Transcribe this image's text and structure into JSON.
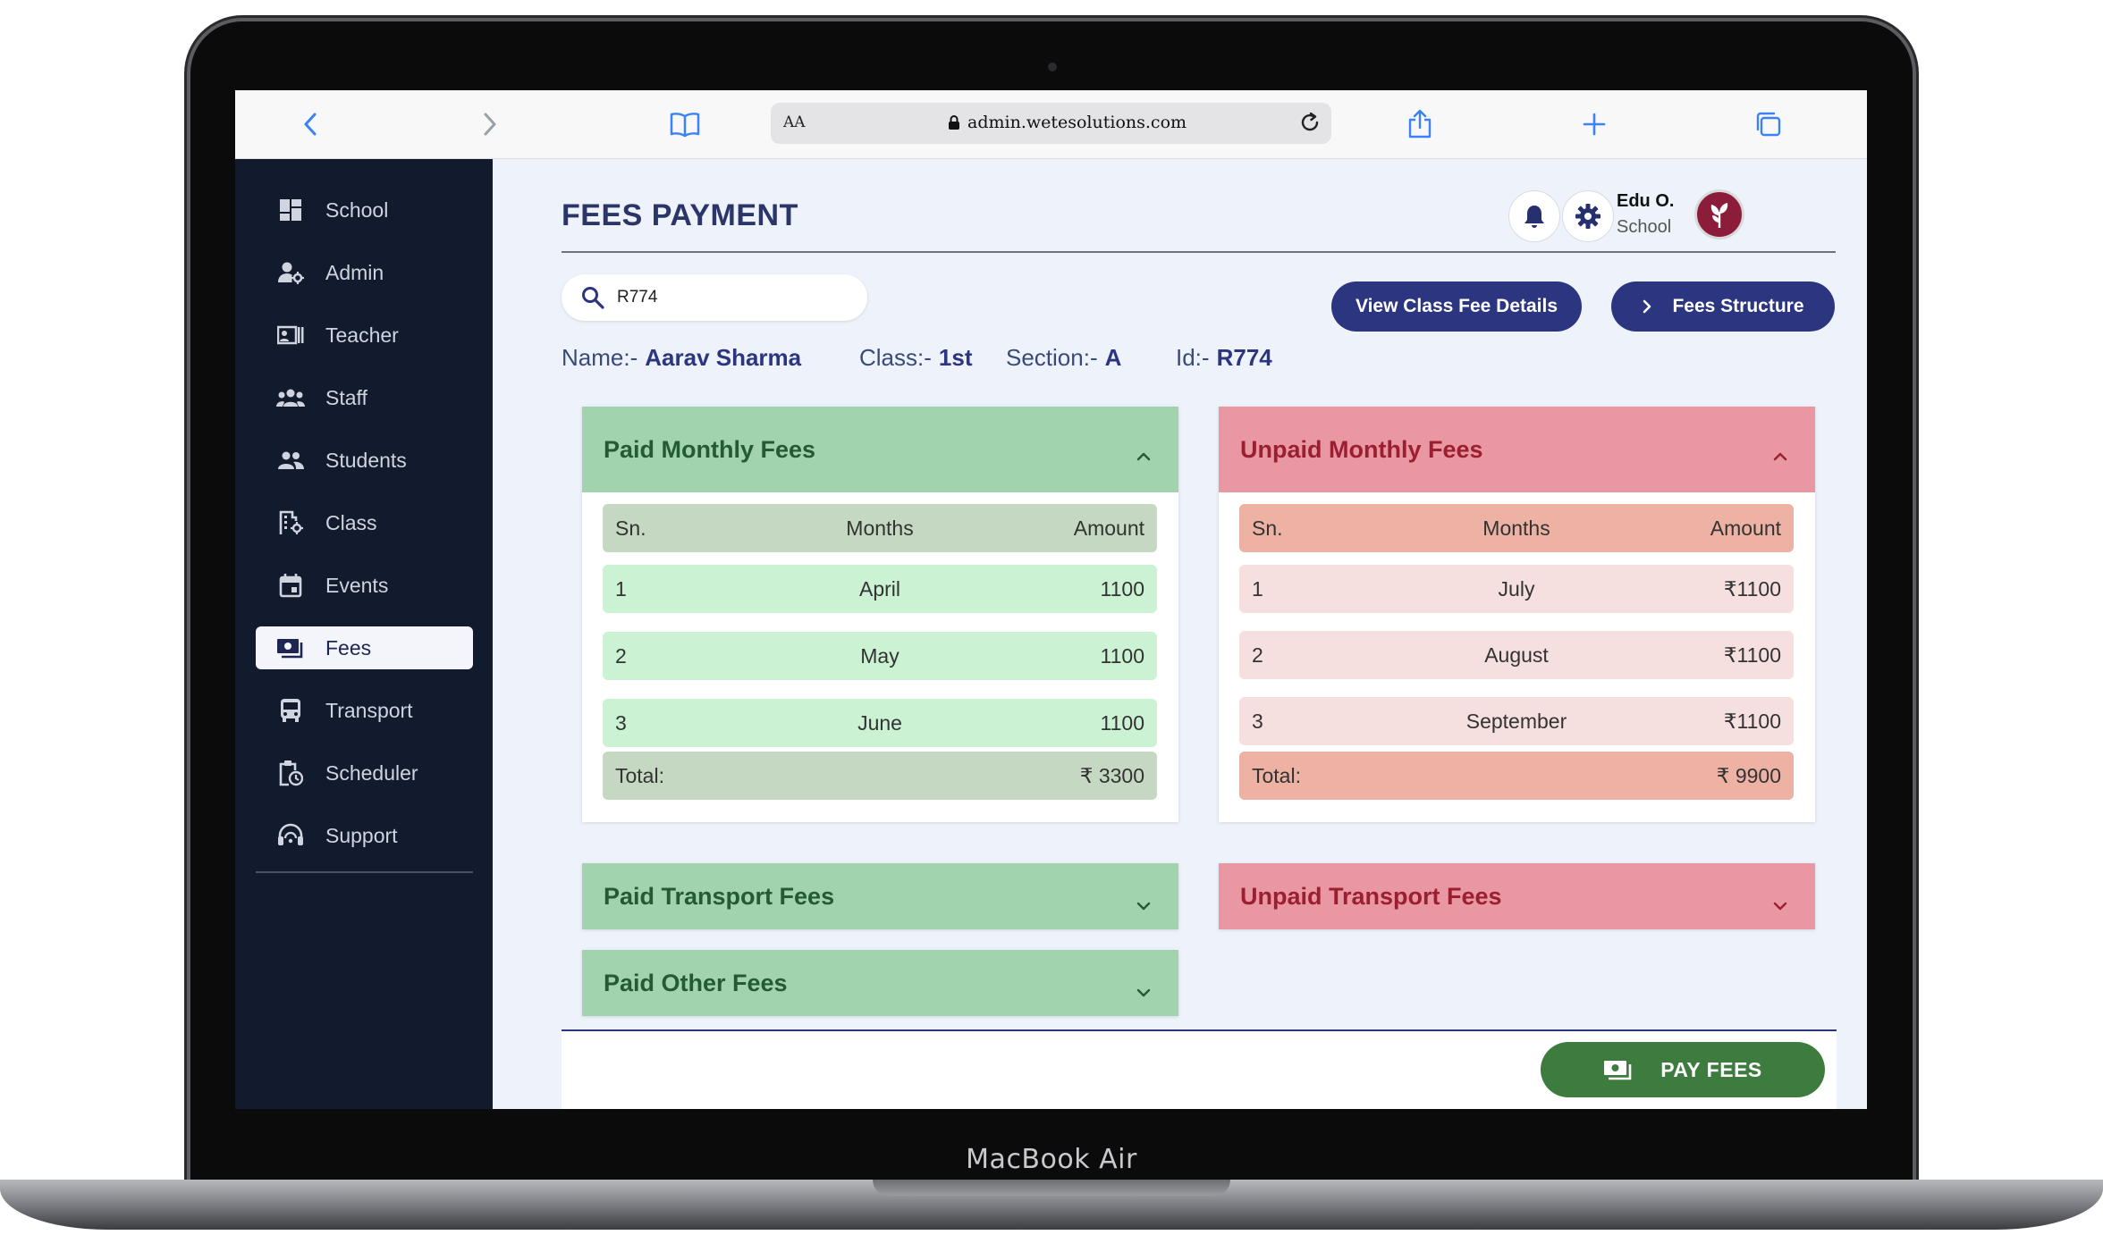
{
  "device": {
    "label": "MacBook Air"
  },
  "browser": {
    "text_size_label": "AA",
    "url": "admin.wetesolutions.com"
  },
  "sidebar": {
    "items": [
      {
        "label": "School",
        "icon": "dashboard-icon"
      },
      {
        "label": "Admin",
        "icon": "admin-user-icon"
      },
      {
        "label": "Teacher",
        "icon": "teacher-icon"
      },
      {
        "label": "Staff",
        "icon": "staff-group-icon"
      },
      {
        "label": "Students",
        "icon": "students-icon"
      },
      {
        "label": "Class",
        "icon": "class-icon"
      },
      {
        "label": "Events",
        "icon": "calendar-icon"
      },
      {
        "label": "Fees",
        "icon": "money-icon",
        "active": true
      },
      {
        "label": "Transport",
        "icon": "bus-icon"
      },
      {
        "label": "Scheduler",
        "icon": "clipboard-clock-icon"
      },
      {
        "label": "Support",
        "icon": "headset-icon"
      }
    ]
  },
  "header": {
    "title": "FEES PAYMENT",
    "user_name": "Edu O.",
    "user_role": "School"
  },
  "search": {
    "value": "R774"
  },
  "actions": {
    "view_class_fee": "View Class Fee Details",
    "fees_structure": "Fees Structure"
  },
  "student": {
    "name_label": "Name:-",
    "name": "Aarav Sharma",
    "class_label": "Class:-",
    "class": "1st",
    "section_label": "Section:-",
    "section": "A",
    "id_label": "Id:-",
    "id": "R774"
  },
  "paid_monthly": {
    "title": "Paid Monthly Fees",
    "columns": [
      "Sn.",
      "Months",
      "Amount"
    ],
    "rows": [
      {
        "sn": "1",
        "month": "April",
        "amount": "1100"
      },
      {
        "sn": "2",
        "month": "May",
        "amount": "1100"
      },
      {
        "sn": "3",
        "month": "June",
        "amount": "1100"
      }
    ],
    "total_label": "Total:",
    "total": "₹ 3300"
  },
  "unpaid_monthly": {
    "title": "Unpaid Monthly Fees",
    "columns": [
      "Sn.",
      "Months",
      "Amount"
    ],
    "rows": [
      {
        "sn": "1",
        "month": "July",
        "amount": "₹1100"
      },
      {
        "sn": "2",
        "month": "August",
        "amount": "₹1100"
      },
      {
        "sn": "3",
        "month": "September",
        "amount": "₹1100"
      }
    ],
    "total_label": "Total:",
    "total": "₹ 9900"
  },
  "paid_transport": {
    "title": "Paid Transport Fees"
  },
  "unpaid_transport": {
    "title": "Unpaid Transport Fees"
  },
  "paid_other": {
    "title": "Paid Other Fees"
  },
  "pay_button": {
    "label": "PAY FEES"
  },
  "colors": {
    "sidebar_bg": "#121a2e",
    "primary": "#2b3580",
    "paid_header": "#a1d3ae",
    "unpaid_header": "#e897a3",
    "pay_button": "#3e7b3f"
  }
}
